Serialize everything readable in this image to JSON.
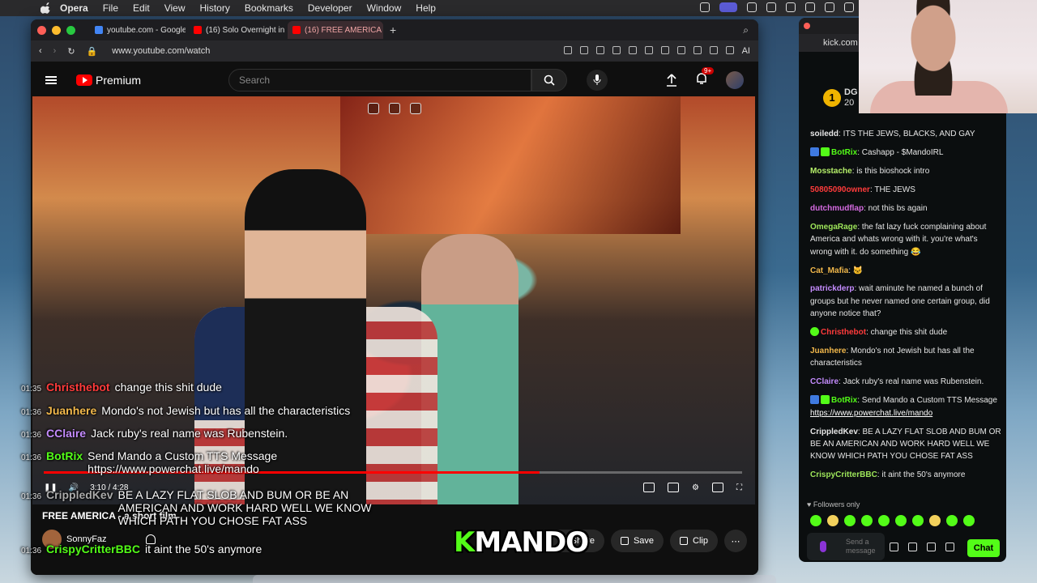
{
  "menubar": {
    "items": [
      "Opera",
      "File",
      "Edit",
      "View",
      "History",
      "Bookmarks",
      "Developer",
      "Window",
      "Help"
    ]
  },
  "browser": {
    "tabs": [
      {
        "label": "youtube.com - Google S",
        "color": "#4285f4"
      },
      {
        "label": "(16) Solo Overnight in H",
        "color": "#ff0000"
      },
      {
        "label": "(16) FREE AMERICA",
        "color": "#ff0000",
        "active": true
      }
    ],
    "url": "www.youtube.com/watch",
    "ai_label": "AI"
  },
  "youtube": {
    "logo_text": "Premium",
    "search_placeholder": "Search",
    "notification_count": "9+",
    "player": {
      "current_time": "3:10",
      "duration": "4:28",
      "progress": 0.71
    },
    "video_title": "FREE AMERICA - a short film",
    "channel_name": "SonnyFaz",
    "actions": {
      "share": "Share",
      "save": "Save",
      "clip": "Clip"
    }
  },
  "overlay": {
    "messages": [
      {
        "time": "01:35",
        "user": "Christhebot",
        "user_color": "#ff3b3b",
        "text": "change this shit dude"
      },
      {
        "time": "01:36",
        "user": "Juanhere",
        "user_color": "#f2b84b",
        "text": "Mondo's not Jewish but has all the characteristics"
      },
      {
        "time": "01:36",
        "user": "CClaire",
        "user_color": "#c58cff",
        "text": "Jack ruby's real name was Rubenstein."
      },
      {
        "time": "01:36",
        "user": "BotRix",
        "user_color": "#53fc18",
        "text": "Send Mando a Custom TTS Message https://www.powerchat.live/mando"
      },
      {
        "time": "01:36",
        "user": "CrippledKev",
        "user_color": "#aaaaaa",
        "text": "BE A LAZY FLAT SLOB AND BUM OR BE AN AMERICAN AND WORK HARD WELL WE KNOW WHICH PATH YOU CHOSE FAT ASS"
      },
      {
        "time": "01:36",
        "user": "CrispyCritterBBC",
        "user_color": "#53fc18",
        "text": "it aint the 50's anymore"
      }
    ],
    "logo_k": "K",
    "logo_rest": "MANDO"
  },
  "kick": {
    "url": "kick.com",
    "leader_rank": "1",
    "leader_name": "DG",
    "leader_sub": "20",
    "chat": [
      {
        "user": "soiledd",
        "color": "#e6e6e6",
        "text": "ITS THE JEWS, BLACKS, AND GAY"
      },
      {
        "user": "BotRix",
        "color": "#53fc18",
        "badges": true,
        "text": "Cashapp - $MandoIRL"
      },
      {
        "user": "Mosstache",
        "color": "#b6f06a",
        "text": "is this bioshock intro"
      },
      {
        "user": "50805090owner",
        "color": "#ff3b3b",
        "text": "THE JEWS"
      },
      {
        "user": "dutchmudflap",
        "color": "#d46ae0",
        "text": "not this bs again"
      },
      {
        "user": "OmegaRage",
        "color": "#9ee65a",
        "text": "the fat lazy fuck complaining about America and whats wrong with it. you're what's wrong with it. do something 😂"
      },
      {
        "user": "Cat_Mafia",
        "color": "#f2b84b",
        "text": "🐱"
      },
      {
        "user": "patrickderp",
        "color": "#c58cff",
        "text": "wait aminute he named a bunch of groups but he never named one certain group, did anyone notice that?"
      },
      {
        "user": "Christhebot",
        "color": "#ff3b3b",
        "text": "change this shit dude"
      },
      {
        "user": "Juanhere",
        "color": "#f2b84b",
        "text": "Mondo's not Jewish but has all the characteristics"
      },
      {
        "user": "CClaire",
        "color": "#c58cff",
        "text": "Jack ruby's real name was Rubenstein."
      },
      {
        "user": "BotRix",
        "color": "#53fc18",
        "badges": true,
        "text": "Send Mando a Custom TTS Message",
        "link": "https://www.powerchat.live/mando"
      },
      {
        "user": "CrippledKev",
        "color": "#e6e6e6",
        "text": "BE A LAZY FLAT SLOB AND BUM OR BE AN AMERICAN AND WORK HARD WELL WE KNOW WHICH PATH YOU CHOSE FAT ASS"
      },
      {
        "user": "CrispyCritterBBC",
        "color": "#9ee65a",
        "text": "it aint the 50's anymore"
      }
    ],
    "followers_only": "Followers only",
    "input_placeholder": "Send a message",
    "chat_button": "Chat"
  }
}
